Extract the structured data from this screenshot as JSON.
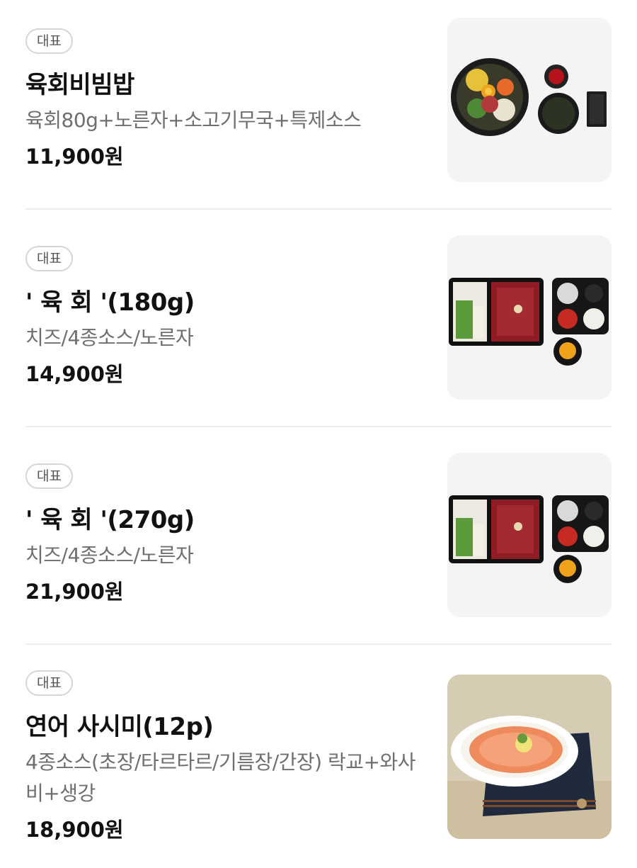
{
  "menu": {
    "items": [
      {
        "badge": "대표",
        "name": "육회비빔밥",
        "description": "육회80g+노른자+소고기무국+특제소스",
        "price": "11,900원",
        "image": "bibimbap-set-image"
      },
      {
        "badge": "대표",
        "name": "' 육 회 '(180g)",
        "description": "치즈/4종소스/노른자",
        "price": "14,900원",
        "image": "yukhoe-box-image"
      },
      {
        "badge": "대표",
        "name": "' 육 회 '(270g)",
        "description": "치즈/4종소스/노른자",
        "price": "21,900원",
        "image": "yukhoe-box-image"
      },
      {
        "badge": "대표",
        "name": "연어 사시미(12p)",
        "description": "4종소스(초장/타르타르/기름장/간장) 락교+와사비+생강",
        "price": "18,900원",
        "image": "salmon-sashimi-image"
      }
    ]
  }
}
